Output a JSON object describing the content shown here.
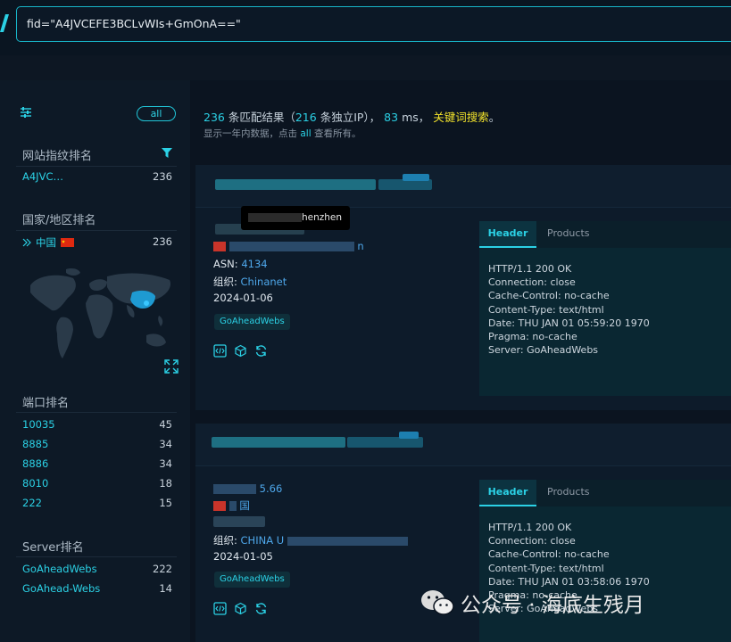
{
  "search": {
    "query": "fid=\"A4JVCEFE3BCLvWIs+GmOnA==\""
  },
  "sidebar": {
    "all_label": "all",
    "fingerprint": {
      "title": "网站指纹排名",
      "items": [
        {
          "label": "A4JVC…",
          "count": "236"
        }
      ]
    },
    "country": {
      "title": "国家/地区排名",
      "items": [
        {
          "label": "中国",
          "count": "236"
        }
      ]
    },
    "ports": {
      "title": "端口排名",
      "items": [
        {
          "label": "10035",
          "count": "45"
        },
        {
          "label": "8885",
          "count": "34"
        },
        {
          "label": "8886",
          "count": "34"
        },
        {
          "label": "8010",
          "count": "18"
        },
        {
          "label": "222",
          "count": "15"
        }
      ]
    },
    "server": {
      "title": "Server排名",
      "items": [
        {
          "label": "GoAheadWebs",
          "count": "222"
        },
        {
          "label": "GoAhead-Webs",
          "count": "14"
        }
      ]
    }
  },
  "summary": {
    "total": "236",
    "t1": "条匹配结果（",
    "ips": "216",
    "t2": "条独立IP），",
    "ms": "83",
    "t3": "ms，",
    "keyword": "关键词搜索",
    "t4": "。",
    "note_a": "显示一年内数据，点击",
    "note_link": "all",
    "note_b": "查看所有。"
  },
  "results": [
    {
      "tooltip": "henzhen",
      "location_suffix": "n",
      "asn_label": "ASN:",
      "asn": "4134",
      "org_label": "组织:",
      "org": "Chinanet",
      "date": "2024-01-06",
      "tag": "GoAheadWebs",
      "tab_header": "Header",
      "tab_products": "Products",
      "header_text": "HTTP/1.1 200 OK\nConnection: close\nCache-Control: no-cache\nContent-Type: text/html\nDate: THU JAN 01 05:59:20 1970\nPragma: no-cache\nServer: GoAheadWebs"
    },
    {
      "ip_suffix": "5.66",
      "country_suffix": "国",
      "org_label": "组织:",
      "org": "CHINA U",
      "date": "2024-01-05",
      "tag": "GoAheadWebs",
      "tab_header": "Header",
      "tab_products": "Products",
      "header_text": "HTTP/1.1 200 OK\nConnection: close\nCache-Control: no-cache\nContent-Type: text/html\nDate: THU JAN 01 03:58:06 1970\nPragma: no-cache\nServer: GoAheadWebs"
    }
  ],
  "watermark": {
    "text": "公众号 · 海底生残月"
  },
  "colors": {
    "accent": "#2bd1e5",
    "keyword": "#f3e32b",
    "link": "#4ea7ea"
  }
}
